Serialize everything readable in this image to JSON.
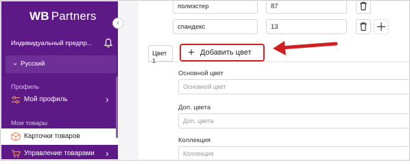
{
  "sidebar": {
    "logo_wb": "WB",
    "logo_partners": "Partners",
    "org_name": "Индивидуальный предпр...",
    "language": "Русский",
    "section_profile": "Профиль",
    "my_profile": "Мой профиль",
    "section_goods": "Мои товары",
    "product_cards": "Карточки товаров",
    "goods_management": "Управление товарами"
  },
  "composition": [
    {
      "material": "полиэстер",
      "percent": "87"
    },
    {
      "material": "спандекс",
      "percent": "13"
    }
  ],
  "tabs": {
    "color1": "Цвет 1",
    "add_color": "Добавить цвет"
  },
  "fields": {
    "main_color_label": "Основной цвет",
    "main_color_placeholder": "Основной цвет",
    "extra_colors_label": "Доп. цвета",
    "extra_colors_placeholder": "Доп. цвета",
    "collection_label": "Коллекция",
    "collection_placeholder": "Коллекция"
  },
  "colors": {
    "sidebar_bg": "#5d1a86",
    "highlight": "#d11f1f"
  },
  "icons": [
    "collapse-icon",
    "bell-icon",
    "chevron-down-icon",
    "profile-sliders-icon",
    "chevron-right-icon",
    "box-icon",
    "cart-icon",
    "trash-icon",
    "plus-icon",
    "dropdown-chevron-icon",
    "arrow-annotation-icon"
  ]
}
